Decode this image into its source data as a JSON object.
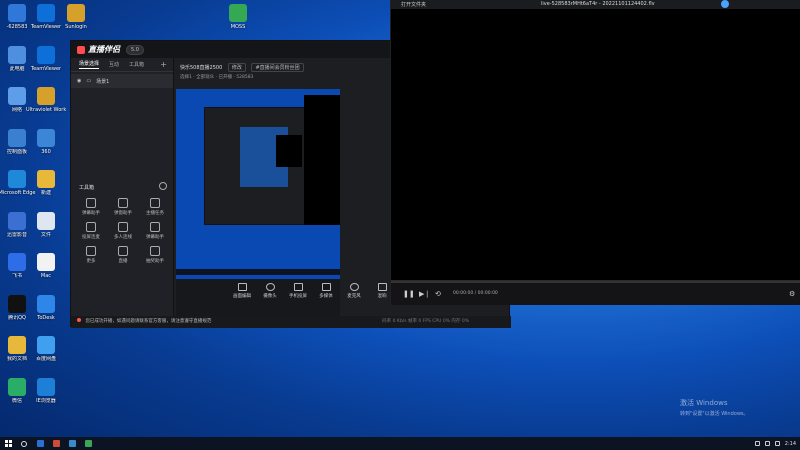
{
  "desktop": {
    "icons_col1": [
      {
        "label": "-628583",
        "icon": "qr-app-icon",
        "color": "#2f77d8"
      },
      {
        "label": "此电脑",
        "icon": "computer-icon",
        "color": "#4f8fe0"
      },
      {
        "label": "网络",
        "icon": "network-icon",
        "color": "#5e9de8"
      },
      {
        "label": "控制面板",
        "icon": "control-panel-icon",
        "color": "#3a7fd0"
      },
      {
        "label": "Microsoft Edge",
        "icon": "edge-icon",
        "color": "#1f88d8"
      },
      {
        "label": "迅雷影音",
        "icon": "thunder-player-icon",
        "color": "#3b6fd1"
      },
      {
        "label": "飞书",
        "icon": "feishu-icon",
        "color": "#2d6ee8"
      },
      {
        "label": "腾讯QQ",
        "icon": "qq-icon",
        "color": "#111111"
      },
      {
        "label": "我的文档",
        "icon": "folder-icon",
        "color": "#e8b83a"
      },
      {
        "label": "微信",
        "icon": "wechat-icon",
        "color": "#2aae67"
      }
    ],
    "icons_col2": [
      {
        "label": "TeamViewer",
        "icon": "teamviewer-icon",
        "color": "#0e6fd8"
      },
      {
        "label": "TeamViewer",
        "icon": "teamviewer-icon",
        "color": "#0e6fd8"
      },
      {
        "label": "Ultraviolet Workstation",
        "icon": "workstation-icon",
        "color": "#d6a12b"
      },
      {
        "label": "360",
        "icon": "browser-icon",
        "color": "#3c86d6"
      },
      {
        "label": "新建",
        "icon": "folder-icon",
        "color": "#e8b83a"
      },
      {
        "label": "文件",
        "icon": "document-icon",
        "color": "#dfe6f0"
      },
      {
        "label": "Mac",
        "icon": "mac-icon",
        "color": "#f2f2f2"
      },
      {
        "label": "ToDesk",
        "icon": "todesk-icon",
        "color": "#2e86e8"
      },
      {
        "label": "百度网盘",
        "icon": "baidu-cloud-icon",
        "color": "#3fa0f0"
      },
      {
        "label": "IE浏览器",
        "icon": "ie-icon",
        "color": "#1d7fd6"
      }
    ],
    "top_icons": [
      {
        "label": "Remote",
        "icon": "remote-icon",
        "color": "#1169d6"
      },
      {
        "label": "Sunlogin",
        "icon": "package-icon",
        "color": "#d6a12b"
      },
      {
        "label": "MOSS",
        "icon": "home-app-icon",
        "color": "#34a853"
      }
    ]
  },
  "app": {
    "brand": "直播伴侣",
    "version": "5.0",
    "tabs": [
      "场景选择",
      "互动",
      "工具箱"
    ],
    "scene_name": "场景1",
    "toolbox_title": "工具箱",
    "tools": [
      "弹幕助手",
      "弹窗助手",
      "主播任务",
      "投屏连麦",
      "多人连线",
      "弹幕助手",
      "更多",
      "直播",
      "抽奖助手"
    ],
    "room_title": "快乐508直播2500",
    "room_chip1": "修改",
    "room_chip2": "#直播间会员粉丝团",
    "room_meta": "选择1 · 全部观众  · 已开播 · 528583",
    "controls": [
      "画面编辑",
      "摄像头",
      "手机投屏",
      "多媒体",
      "麦克风",
      "混响"
    ],
    "notice": "您已成功开播，如遇问题请联系官方客服，请注意遵守直播规范",
    "stats": "码率 0 Kb/s  帧率 0 FPS  CPU 0%  内存 0%"
  },
  "player": {
    "open_label": "打开文件夹",
    "filename": "live-528583rMHt6aT4r - 20221101124402.flv",
    "time": "00:00:00 / 00:00:00"
  },
  "watermark": {
    "title": "激活 Windows",
    "subtitle": "转到\"设置\"以激活 Windows。"
  },
  "taskbar": {
    "time": "2:14",
    "apps": [
      "#2a6fd6",
      "#d04a3a",
      "#3a8ad0",
      "#3aa655"
    ]
  }
}
